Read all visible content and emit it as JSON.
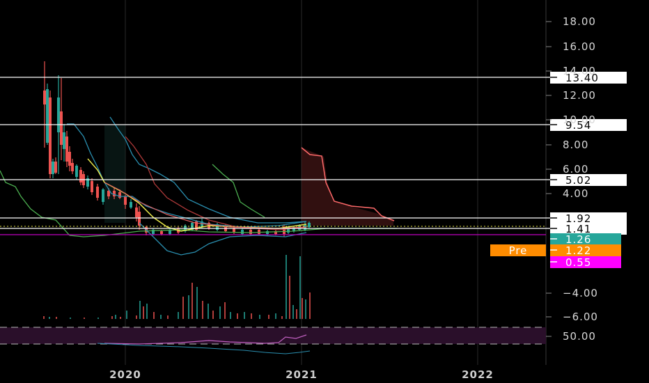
{
  "chart_data": {
    "type": "candlestick",
    "price_axis": {
      "ticks": [
        "18.00",
        "16.00",
        "14.00",
        "12.00",
        "10.00",
        "8.00",
        "6.00",
        "4.00",
        "−4.00",
        "−6.00"
      ]
    },
    "rsi_axis": {
      "ticks": [
        "50.00"
      ]
    },
    "time_axis": {
      "ticks": [
        "2020",
        "2021",
        "2022"
      ]
    },
    "horizontal_levels": [
      {
        "value": 13.4,
        "label": "13.40"
      },
      {
        "value": 9.54,
        "label": "9.54"
      },
      {
        "value": 5.02,
        "label": "5.02"
      },
      {
        "value": 1.92,
        "label": "1.92"
      },
      {
        "value": 1.41,
        "label": "1.41"
      }
    ],
    "price_badges": [
      {
        "label": "1.26",
        "color": "#26a69a",
        "text_color": "#ffffff"
      },
      {
        "label": "1.22",
        "prefix": "Pre",
        "color": "#ff8c00",
        "text_color": "#ffffff"
      },
      {
        "label": "0.55",
        "color": "#ff00ff",
        "text_color": "#ffffff"
      }
    ],
    "colors": {
      "up": "#26a69a",
      "down": "#ef5350",
      "ema_fast": "#e8e84a",
      "ema_mid": "#ef5350",
      "bands": "#2a8fb0",
      "lagging": "#4caf50",
      "cloud": "#5a1e1e",
      "rsi": "#c060c0",
      "magenta_line": "#c000c0"
    }
  }
}
